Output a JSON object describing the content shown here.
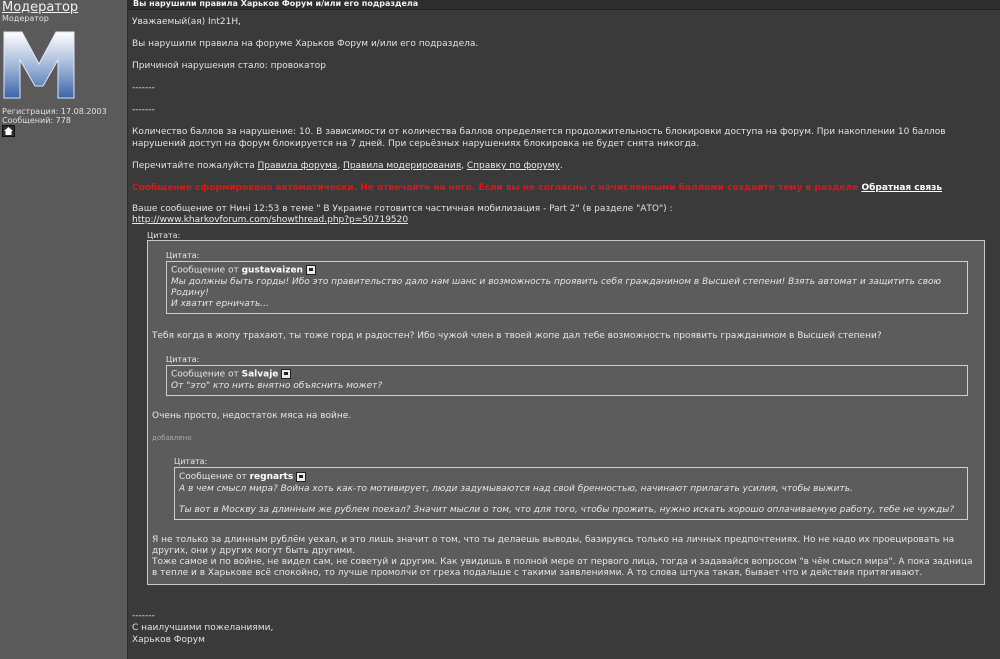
{
  "sidebar": {
    "username": "Модератор",
    "user_title": "Модератор",
    "reg": "Регистрация: 17.08.2003",
    "posts": "Сообщений: 778"
  },
  "header": {
    "subject": "Вы нарушили правила Харьков Форум и/или его подраздела"
  },
  "message": {
    "greeting": "Уважаемый(ая) Int21H,",
    "line1": "Вы нарушили правила на форуме Харьков Форум и/или его подраздела.",
    "reason": "Причиной нарушения стало: провокатор",
    "sep1": "-------",
    "sep2": "-------",
    "points": "Количество баллов за нарушение: 10. В зависимости от количества баллов определяется продолжительность блокировки доступа на форум. При накоплении 10 баллов нарушений доступ на форум блокируется на 7 дней. При серьёзных нарушениях блокировка не будет снята никогда.",
    "read_prefix": "Перечитайте пожалуйста ",
    "link_rules": "Правила форума",
    "comma1": ", ",
    "link_mod": "Правила модерирования",
    "comma2": ", ",
    "link_help": "Справку по форуму",
    "read_suffix": ".",
    "auto_warning": "Сообщение сформировано автоматически. Не отвечайте на него. Если вы не согласны с начисленными баллами создайте тему в разделе ",
    "link_feedback": "Обратная связь",
    "post_ref": "Ваше сообщение от Нині 12:53 в теме \" В Украине готовится частичная мобилизация - Part 2\" (в разделе \"АТО\") :",
    "post_url": "http://www.kharkovforum.com/showthread.php?p=50719520"
  },
  "quote": {
    "label": "Цитата:",
    "q1_label": "Цитата:",
    "q1_from_prefix": "Сообщение от ",
    "q1_author": "gustavaizen",
    "q1_text1": "Мы должны быть горды! Ибо это правительство дало нам шанс и возможность проявить себя гражданином в Высшей степени! Взять автомат и защитить свою Родину!",
    "q1_text2": "И хватит ерничать...",
    "p1": "Тебя когда в жопу трахают, ты тоже горд и радостен? Ибо чужой член в твоей жопе дал тебе возможность проявить гражданином в Высшей степени?",
    "q2_label": "Цитата:",
    "q2_from_prefix": "Сообщение от ",
    "q2_author": "Salvaje",
    "q2_text": "От \"это\" кто нить внятно объяснить может?",
    "p2": "Очень просто, недостаток мяса на войне.",
    "added": "добавлено",
    "q3_label": "Цитата:",
    "q3_from_prefix": "Сообщение от ",
    "q3_author": "regnarts",
    "q3_text1": "А в чем смысл мира? Война хоть как-то мотивирует, люди задумываются над свой бренностью, начинают прилагать усилия, чтобы выжить.",
    "q3_text2": "Ты вот в Москву за длинным же рублем поехал? Значит мысли о том, что для того, чтобы прожить, нужно искать хорошо оплачиваемую работу, тебе не чужды?",
    "p3a": "Я не только за длинным рублём уехал, и это лишь значит о том, что ты делаешь выводы, базируясь только на личных предпочтениях. Но не надо их проецировать на других, они у других могут быть другими.",
    "p3b": "Тоже самое и по войне, не видел сам, не советуй и другим. Как увидишь в полной мере от первого лица, тогда и задавайся вопросом \"в чём смысл мира\". А пока задница в тепле и в Харькове всё спокойно, то лучше промолчи от греха подальше с такими заявлениями. А то слова штука такая, бывает что и действия притягивают."
  },
  "signature": {
    "sep": "-------",
    "line1": "С наилучшими пожеланиями,",
    "line2": "Харьков Форум"
  },
  "colors": {
    "accent_red": "#e01515",
    "background": "#3a3a3a",
    "sidebar": "#5a5a5a",
    "quote_bg": "#5c5c5c"
  }
}
